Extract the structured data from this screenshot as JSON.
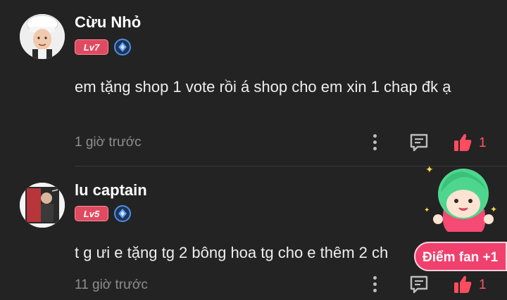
{
  "comments": [
    {
      "username": "Cừu Nhỏ",
      "level": "Lv7",
      "text": "em tặng shop 1 vote rồi á shop cho em xin 1 chap đk ạ",
      "time": "1 giờ trước",
      "likes": "1"
    },
    {
      "username": "lu captain",
      "level": "Lv5",
      "text": "t g ưi e tặng tg 2 bông hoa tg cho e thêm 2 ch",
      "time": "11 giờ trước",
      "likes": "1"
    }
  ],
  "fan_badge": "Điểm fan +1",
  "icons": {
    "more": "more-vertical-icon",
    "reply": "comment-icon",
    "like": "thumbs-up-icon",
    "badge": "diamond-badge-icon"
  },
  "colors": {
    "background": "#232323",
    "level_badge": "#e04a60",
    "like": "#ff5566",
    "fan_badge": "#f0406d",
    "mascot": "#4fd68e"
  }
}
